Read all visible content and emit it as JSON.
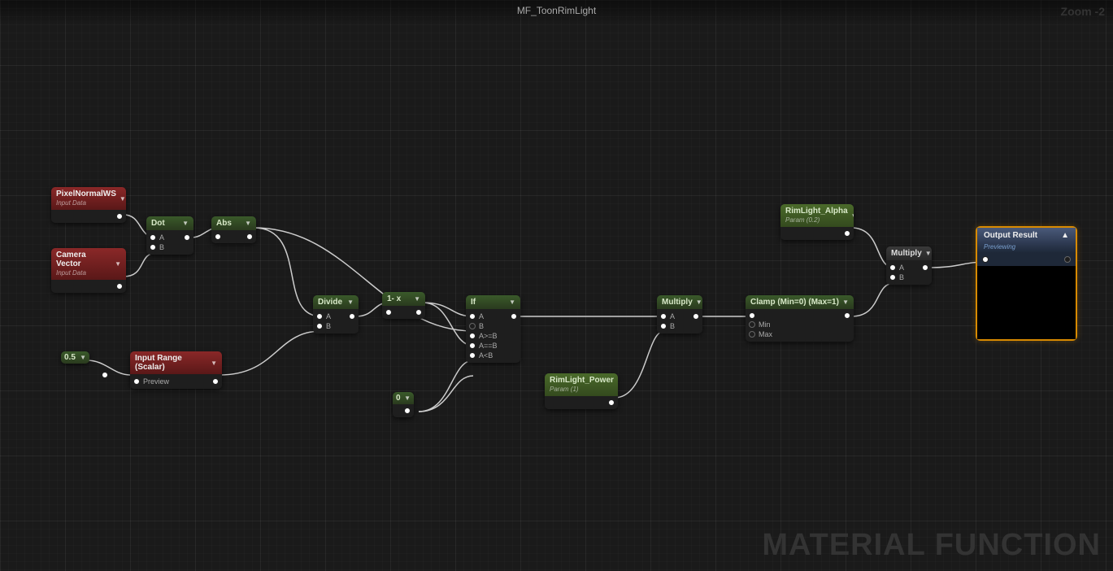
{
  "title": "MF_ToonRimLight",
  "zoom": "Zoom -2",
  "watermark": "MATERIAL FUNCTION",
  "nodes": {
    "pixelNormal": {
      "title": "PixelNormalWS",
      "sub": "Input Data"
    },
    "cameraVector": {
      "title": "Camera Vector",
      "sub": "Input Data"
    },
    "dot": {
      "title": "Dot",
      "inA": "A",
      "inB": "B"
    },
    "abs": {
      "title": "Abs"
    },
    "const05": {
      "title": "0.5"
    },
    "inputRange": {
      "title": "Input Range (Scalar)",
      "preview": "Preview"
    },
    "divide": {
      "title": "Divide",
      "inA": "A",
      "inB": "B"
    },
    "oneMinus": {
      "title": "1- x"
    },
    "const0": {
      "title": "0"
    },
    "ifNode": {
      "title": "If",
      "a": "A",
      "b": "B",
      "agb": "A>=B",
      "aeb": "A==B",
      "alb": "A<B"
    },
    "rimPower": {
      "title": "RimLight_Power",
      "sub": "Param (1)"
    },
    "mult1": {
      "title": "Multiply",
      "inA": "A",
      "inB": "B"
    },
    "clamp": {
      "title": "Clamp (Min=0) (Max=1)",
      "min": "Min",
      "max": "Max"
    },
    "rimAlpha": {
      "title": "RimLight_Alpha",
      "sub": "Param (0.2)"
    },
    "mult2": {
      "title": "Multiply",
      "inA": "A",
      "inB": "B"
    },
    "output": {
      "title": "Output Result",
      "sub": "Previewing"
    }
  }
}
